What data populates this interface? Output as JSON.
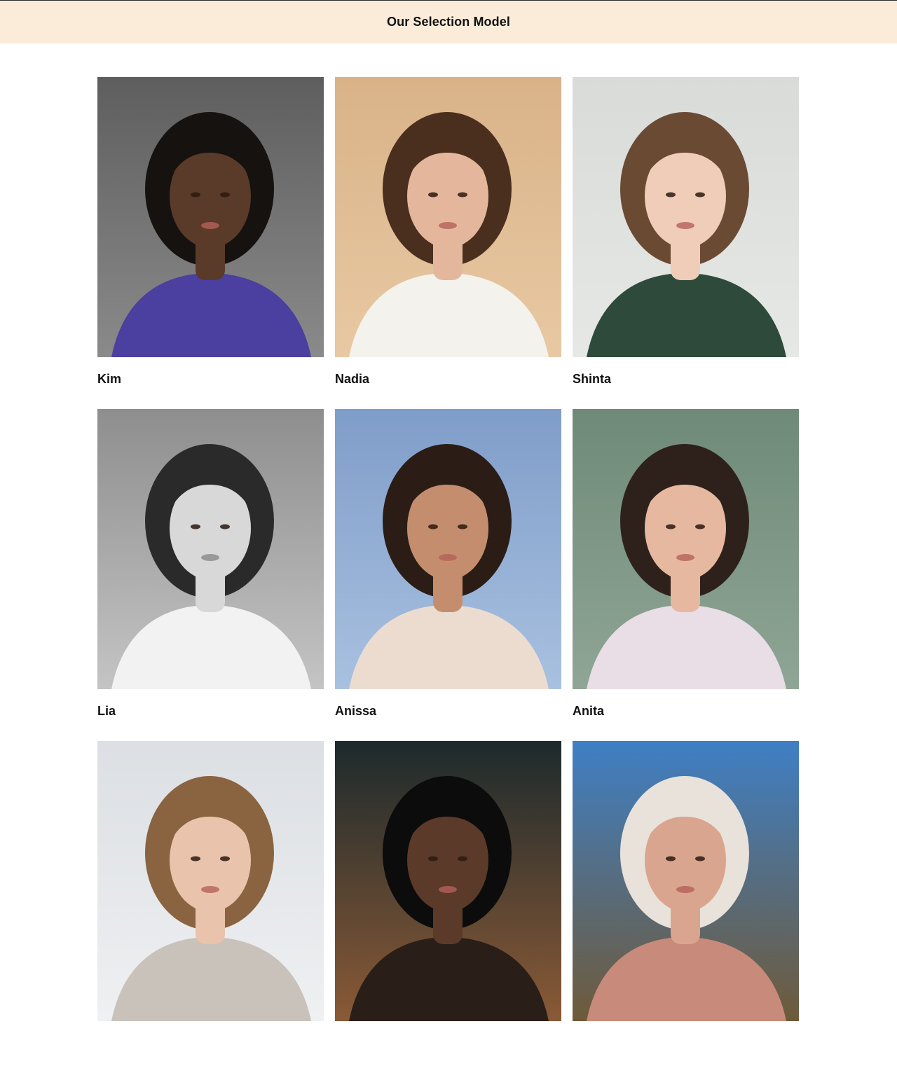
{
  "header": {
    "title": "Our Selection Model",
    "background": "#faecd9"
  },
  "models": [
    {
      "name": "Kim",
      "photo": {
        "bg": "#5e5e5e",
        "bg2": "#8a8a8a",
        "skin": "#5a3a28",
        "hair": "#151210",
        "top": "#4b3fa0",
        "grayscale": false
      }
    },
    {
      "name": "Nadia",
      "photo": {
        "bg": "#d9b288",
        "bg2": "#e8c9a3",
        "skin": "#e4b79c",
        "hair": "#4a2f1e",
        "top": "#f4f2ec",
        "grayscale": false
      }
    },
    {
      "name": "Shinta",
      "photo": {
        "bg": "#d9dbd9",
        "bg2": "#e6e8e6",
        "skin": "#f0cdb8",
        "hair": "#6b4a33",
        "top": "#2e4a3a",
        "grayscale": false
      }
    },
    {
      "name": "Lia",
      "photo": {
        "bg": "#8e8e8e",
        "bg2": "#c4c4c4",
        "skin": "#d8d8d8",
        "hair": "#2a2a2a",
        "top": "#f2f2f2",
        "grayscale": true
      }
    },
    {
      "name": "Anissa",
      "photo": {
        "bg": "#7f9dc9",
        "bg2": "#a9c1e0",
        "skin": "#c48e6e",
        "hair": "#2b1d16",
        "top": "#ecdcd0",
        "grayscale": false
      }
    },
    {
      "name": "Anita",
      "photo": {
        "bg": "#6f8a78",
        "bg2": "#8fa595",
        "skin": "#e7b8a0",
        "hair": "#2e211b",
        "top": "#e9dde6",
        "grayscale": false
      }
    },
    {
      "name": "",
      "photo": {
        "bg": "#dcdfe3",
        "bg2": "#eef0f2",
        "skin": "#e9c3ab",
        "hair": "#8a6440",
        "top": "#c9c2bb",
        "grayscale": false
      }
    },
    {
      "name": "",
      "photo": {
        "bg": "#1d2a2c",
        "bg2": "#8a5a36",
        "skin": "#5b3a2a",
        "hair": "#0c0c0c",
        "top": "#2a1e18",
        "grayscale": false
      }
    },
    {
      "name": "",
      "photo": {
        "bg": "#3f7fc4",
        "bg2": "#6e5a3a",
        "skin": "#d9a58e",
        "hair": "#e8e2da",
        "top": "#c88a7a",
        "grayscale": false
      }
    }
  ]
}
